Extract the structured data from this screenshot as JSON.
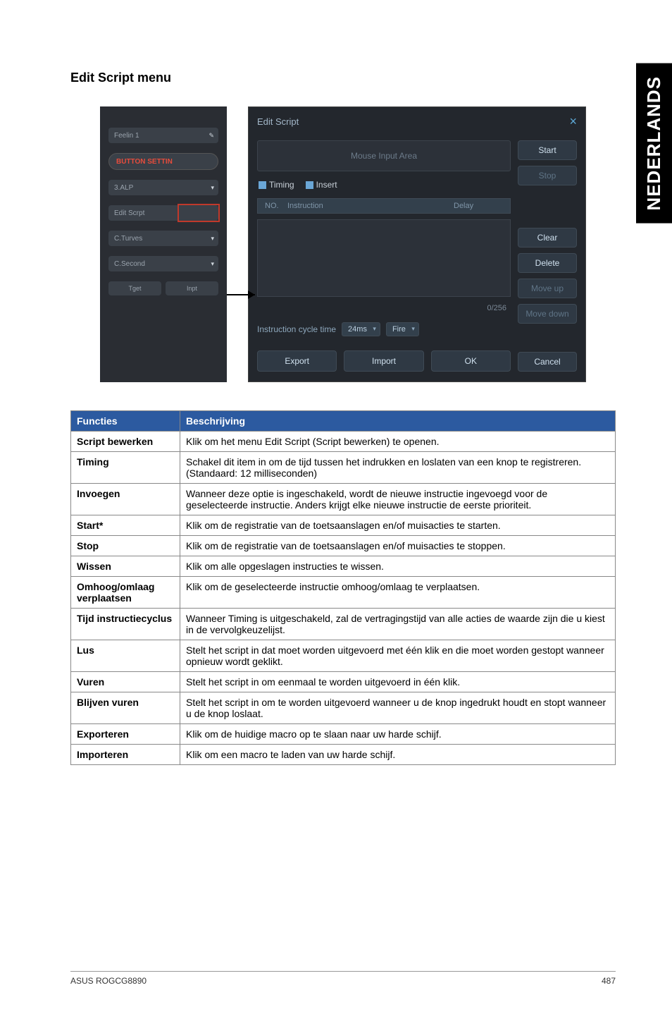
{
  "side_tab": "NEDERLANDS",
  "heading": "Edit Script menu",
  "left_panel": {
    "pill_profile": "Feelin 1",
    "brand": "BUTTON SETTIN",
    "pill_3": "3.ALP",
    "pill_4": "Edit Scrpt",
    "pill_5": "C.Turves",
    "pill_6": "C.Second",
    "btn_target": "Tget",
    "btn_input": "Inpt"
  },
  "dialog": {
    "title": "Edit Script",
    "mouse_area": "Mouse Input Area",
    "tab_timing": "Timing",
    "tab_insert": "Insert",
    "col_no": "NO.",
    "col_instruction": "Instruction",
    "col_delay": "Delay",
    "counter": "0/256",
    "cycle_label": "Instruction cycle time",
    "cycle_value": "24ms",
    "fire_value": "Fire",
    "btn_export": "Export",
    "btn_import": "Import",
    "btn_ok": "OK",
    "side": {
      "start": "Start",
      "stop": "Stop",
      "clear": "Clear",
      "delete": "Delete",
      "moveup": "Move up",
      "movedown": "Move down",
      "cancel": "Cancel"
    }
  },
  "table": {
    "h1": "Functies",
    "h2": "Beschrijving",
    "rows": [
      {
        "fn": "Script bewerken",
        "desc": "Klik om het menu Edit Script (Script bewerken) te openen."
      },
      {
        "fn": "Timing",
        "desc": "Schakel dit item in om de tijd tussen het indrukken en loslaten van een knop te registreren. (Standaard: 12 milliseconden)"
      },
      {
        "fn": "Invoegen",
        "desc": "Wanneer deze optie is ingeschakeld, wordt de nieuwe instructie ingevoegd voor de geselecteerde instructie. Anders krijgt elke nieuwe instructie de eerste prioriteit."
      },
      {
        "fn": "Start*",
        "desc": "Klik om de registratie van de toetsaanslagen en/of muisacties te starten."
      },
      {
        "fn": "Stop",
        "desc": "Klik om de registratie van de toetsaanslagen en/of muisacties te stoppen."
      },
      {
        "fn": "Wissen",
        "desc": "Klik om alle opgeslagen instructies te wissen."
      },
      {
        "fn": "Omhoog/omlaag verplaatsen",
        "desc": "Klik om de geselecteerde instructie omhoog/omlaag te verplaatsen."
      },
      {
        "fn": "Tijd instructiecyclus",
        "desc": "Wanneer Timing is uitgeschakeld, zal de vertragingstijd van alle acties de waarde zijn die u kiest in de vervolgkeuzelijst."
      },
      {
        "fn": "Lus",
        "desc": "Stelt het script in dat moet worden uitgevoerd met één klik en die moet worden gestopt wanneer opnieuw wordt geklikt."
      },
      {
        "fn": "Vuren",
        "desc": "Stelt het script in om eenmaal te worden uitgevoerd in één klik."
      },
      {
        "fn": "Blijven vuren",
        "desc": "Stelt het script in om te worden uitgevoerd wanneer u de knop ingedrukt houdt en stopt wanneer u de knop loslaat."
      },
      {
        "fn": "Exporteren",
        "desc": "Klik om de huidige macro op te slaan naar uw harde schijf."
      },
      {
        "fn": "Importeren",
        "desc": "Klik om een macro te laden van uw harde schijf."
      }
    ]
  },
  "footer": {
    "left": "ASUS ROGCG8890",
    "right": "487"
  }
}
